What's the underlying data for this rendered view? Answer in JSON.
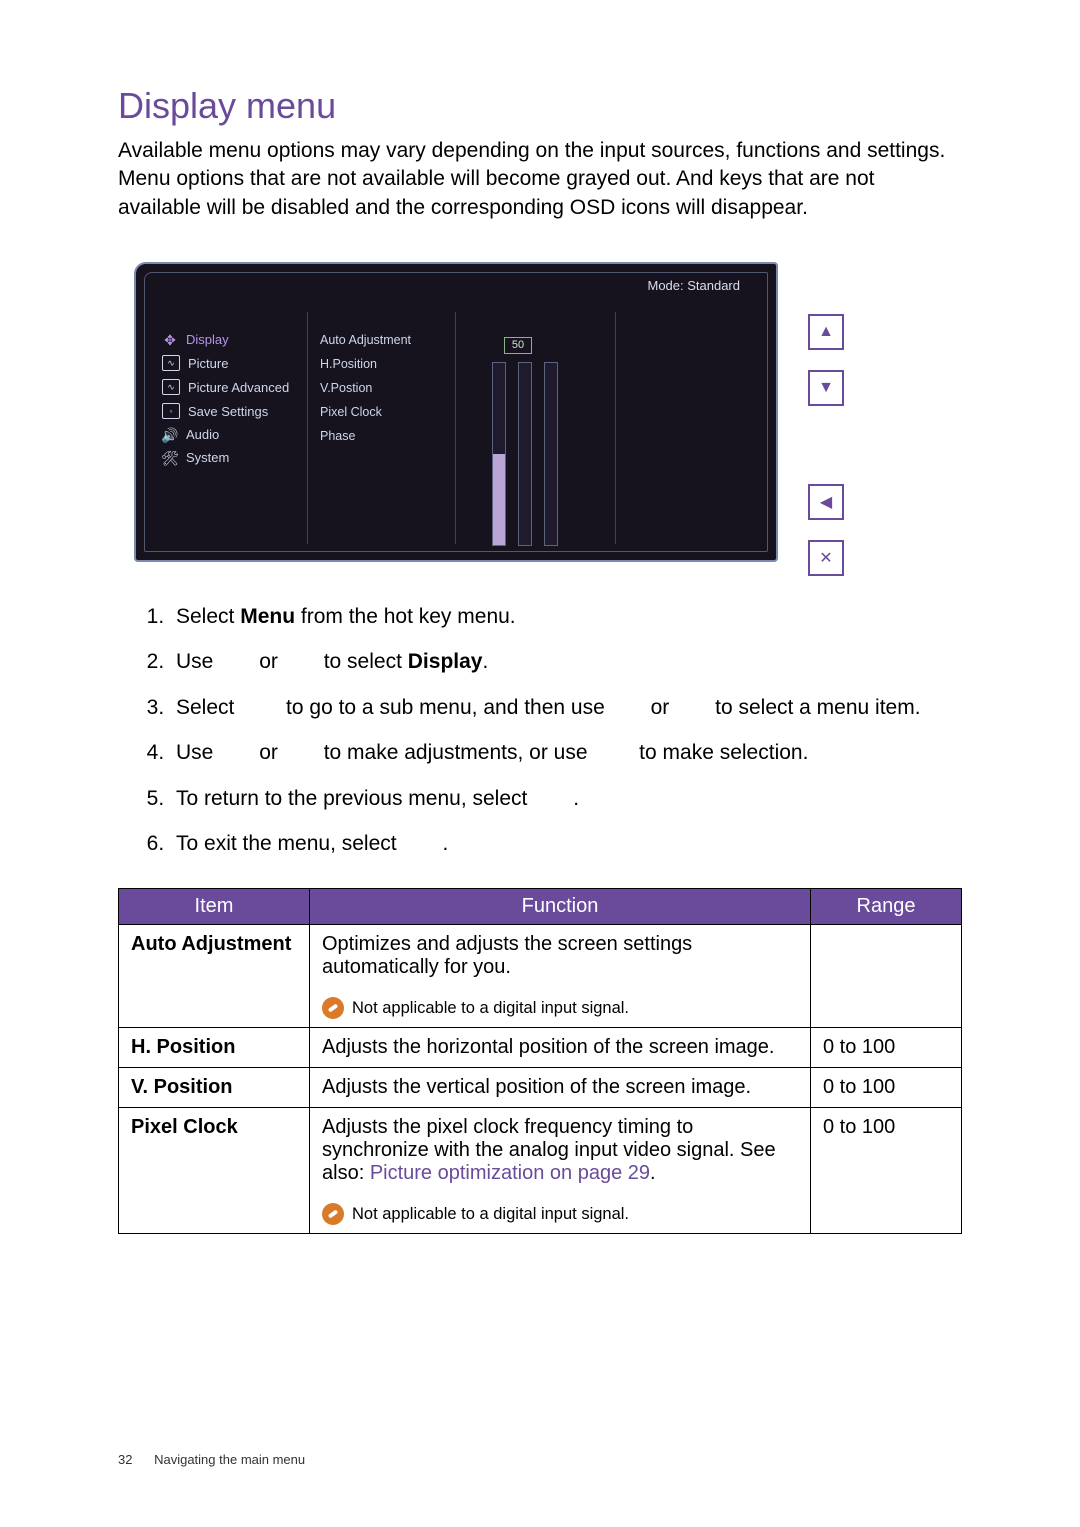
{
  "title": "Display menu",
  "intro": "Available menu options may vary depending on the input sources, functions and settings. Menu options that are not available will become grayed out. And keys that are not available will be disabled and the corresponding OSD icons will disappear.",
  "osd": {
    "mode_label": "Mode: Standard",
    "menu_items": [
      "Display",
      "Picture",
      "Picture Advanced",
      "Save Settings",
      "Audio",
      "System"
    ],
    "sub_items": [
      "Auto Adjustment",
      "H.Position",
      "V.Postion",
      "Pixel Clock",
      "Phase"
    ],
    "value_display": "50"
  },
  "side_buttons": {
    "up": "▲",
    "down": "▼",
    "back": "◀",
    "close": "✕"
  },
  "steps": [
    {
      "prefix": "Select ",
      "bold": "Menu",
      "suffix": " from the hot key menu."
    },
    {
      "prefix": "Use ",
      "gap_or": "or",
      "mid": " to select ",
      "bold": "Display",
      "suffix": "."
    },
    {
      "prefix": "Select ",
      "mid": " to go to a sub menu, and then use ",
      "gap_or": "or",
      "suffix": " to select a menu item."
    },
    {
      "prefix": "Use ",
      "gap_or": "or",
      "mid": " to make adjustments, or use ",
      "suffix": " to make selection."
    },
    {
      "prefix": "To return to the previous menu, select ",
      "suffix": "."
    },
    {
      "prefix": "To exit the menu, select ",
      "suffix": "."
    }
  ],
  "table": {
    "headers": [
      "Item",
      "Function",
      "Range"
    ],
    "rows": [
      {
        "item": "Auto Adjustment",
        "func": "Optimizes and adjusts the screen settings automatically for you.",
        "note": "Not applicable to a digital input signal.",
        "range": ""
      },
      {
        "item": "H. Position",
        "func": "Adjusts the horizontal position of the screen image.",
        "range": "0 to 100"
      },
      {
        "item": "V. Position",
        "func": "Adjusts the vertical position of the screen image.",
        "range": "0 to 100"
      },
      {
        "item": "Pixel Clock",
        "func_pre": "Adjusts the pixel clock frequency timing to synchronize with the analog input video signal. See also: ",
        "xref": "Picture optimization on page 29",
        "func_post": ".",
        "note": "Not applicable to a digital input signal.",
        "range": "0 to 100"
      }
    ]
  },
  "footer": {
    "page": "32",
    "section": "Navigating the main menu"
  }
}
